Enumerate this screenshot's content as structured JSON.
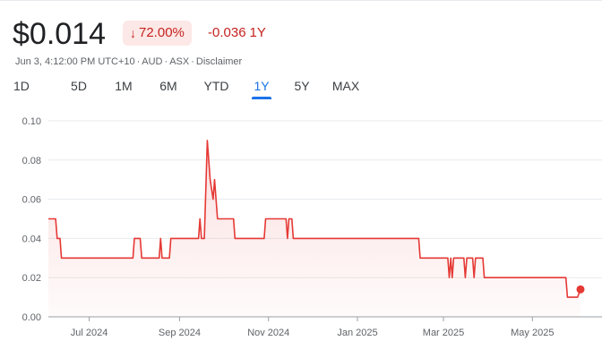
{
  "header": {
    "price": "$0.014",
    "badge": "72.00%",
    "badge_icon": "arrow-down-icon",
    "change_value": "-0.036",
    "change_period": "1Y"
  },
  "meta": {
    "timestamp": "Jun 3, 4:12:00 PM UTC+10",
    "currency": "AUD",
    "exchange": "ASX",
    "disclaimer": "Disclaimer"
  },
  "tabs": [
    {
      "label": "1D",
      "active": false
    },
    {
      "label": "5D",
      "active": false
    },
    {
      "label": "1M",
      "active": false
    },
    {
      "label": "6M",
      "active": false
    },
    {
      "label": "YTD",
      "active": false
    },
    {
      "label": "1Y",
      "active": true
    },
    {
      "label": "5Y",
      "active": false
    },
    {
      "label": "MAX",
      "active": false
    }
  ],
  "colors": {
    "line": "#e53935",
    "negative": "#c5221f",
    "badge_bg": "#fce8e6",
    "accent": "#1a73e8",
    "grid": "#e8eaed"
  },
  "chart_data": {
    "type": "area",
    "ylim": [
      0,
      0.1
    ],
    "y_ticks": [
      "0.00",
      "0.02",
      "0.04",
      "0.06",
      "0.08",
      "0.10"
    ],
    "x_ticks": [
      "Jul 2024",
      "Sep 2024",
      "Nov 2024",
      "Jan 2025",
      "Mar 2025",
      "May 2025"
    ],
    "xlim": [
      "2024-06-03",
      "2025-06-03"
    ],
    "grid": true,
    "series": [
      {
        "points": [
          [
            "2024-06-03",
            0.05
          ],
          [
            "2024-06-08",
            0.05
          ],
          [
            "2024-06-09",
            0.04
          ],
          [
            "2024-06-11",
            0.04
          ],
          [
            "2024-06-12",
            0.03
          ],
          [
            "2024-07-31",
            0.03
          ],
          [
            "2024-08-01",
            0.04
          ],
          [
            "2024-08-05",
            0.04
          ],
          [
            "2024-08-06",
            0.03
          ],
          [
            "2024-08-18",
            0.03
          ],
          [
            "2024-08-19",
            0.04
          ],
          [
            "2024-08-20",
            0.03
          ],
          [
            "2024-08-25",
            0.03
          ],
          [
            "2024-08-26",
            0.04
          ],
          [
            "2024-09-14",
            0.04
          ],
          [
            "2024-09-15",
            0.05
          ],
          [
            "2024-09-16",
            0.04
          ],
          [
            "2024-09-18",
            0.04
          ],
          [
            "2024-09-20",
            0.09
          ],
          [
            "2024-09-22",
            0.07
          ],
          [
            "2024-09-24",
            0.06
          ],
          [
            "2024-09-25",
            0.07
          ],
          [
            "2024-09-27",
            0.05
          ],
          [
            "2024-10-08",
            0.05
          ],
          [
            "2024-10-09",
            0.04
          ],
          [
            "2024-10-29",
            0.04
          ],
          [
            "2024-10-30",
            0.05
          ],
          [
            "2024-11-13",
            0.05
          ],
          [
            "2024-11-14",
            0.04
          ],
          [
            "2024-11-15",
            0.05
          ],
          [
            "2024-11-17",
            0.05
          ],
          [
            "2024-11-18",
            0.04
          ],
          [
            "2025-02-12",
            0.04
          ],
          [
            "2025-02-13",
            0.03
          ],
          [
            "2025-03-04",
            0.03
          ],
          [
            "2025-03-05",
            0.02
          ],
          [
            "2025-03-06",
            0.03
          ],
          [
            "2025-03-07",
            0.02
          ],
          [
            "2025-03-08",
            0.03
          ],
          [
            "2025-03-15",
            0.03
          ],
          [
            "2025-03-16",
            0.02
          ],
          [
            "2025-03-17",
            0.03
          ],
          [
            "2025-03-21",
            0.03
          ],
          [
            "2025-03-22",
            0.02
          ],
          [
            "2025-03-23",
            0.03
          ],
          [
            "2025-03-28",
            0.03
          ],
          [
            "2025-03-29",
            0.02
          ],
          [
            "2025-05-24",
            0.02
          ],
          [
            "2025-05-25",
            0.01
          ],
          [
            "2025-06-01",
            0.01
          ],
          [
            "2025-06-03",
            0.014
          ]
        ]
      }
    ]
  }
}
